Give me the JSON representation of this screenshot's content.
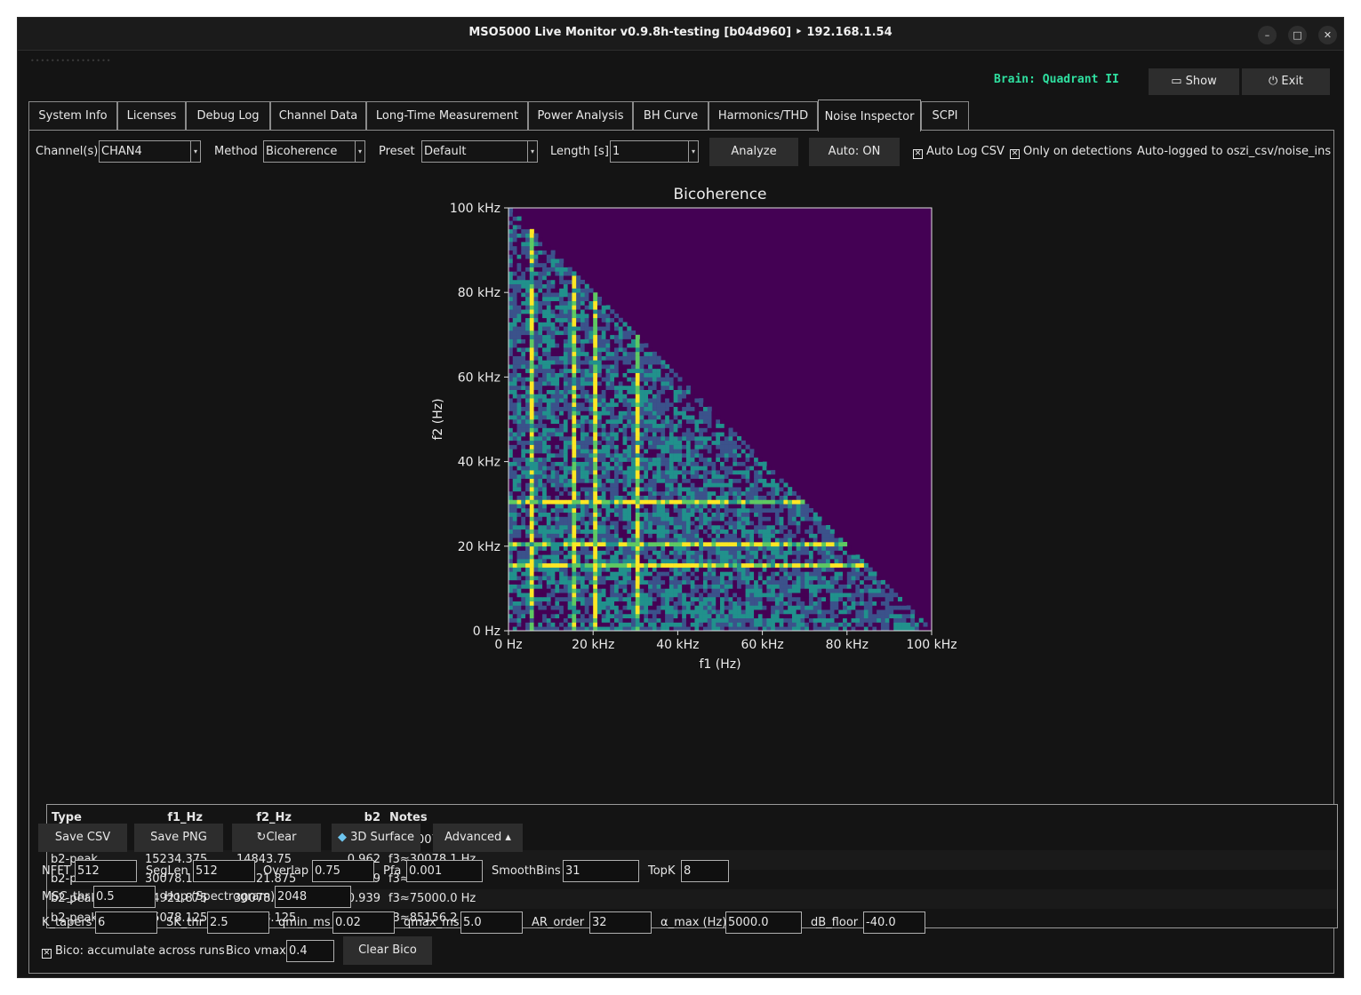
{
  "window": {
    "title": "MSO5000 Live Monitor v0.9.8h-testing [b04d960] ‣ 192.168.1.54",
    "controls": [
      "–",
      "□",
      "✕"
    ]
  },
  "header": {
    "brain_label": "Brain: Quadrant II",
    "show_label": "Show",
    "exit_label": "Exit"
  },
  "tabs": [
    {
      "label": "System Info"
    },
    {
      "label": "Licenses"
    },
    {
      "label": "Debug Log"
    },
    {
      "label": "Channel Data"
    },
    {
      "label": "Long-Time Measurement"
    },
    {
      "label": "Power Analysis"
    },
    {
      "label": "BH Curve"
    },
    {
      "label": "Harmonics/THD"
    },
    {
      "label": "Noise Inspector",
      "active": true
    },
    {
      "label": "SCPI"
    }
  ],
  "controls": {
    "channel_label": "Channel(s)",
    "channel_value": "CHAN4",
    "method_label": "Method",
    "method_value": "Bicoherence",
    "preset_label": "Preset",
    "preset_value": "Default",
    "length_label": "Length [s]",
    "length_value": "1",
    "analyze_label": "Analyze",
    "auto_label": "Auto: ON",
    "auto_log_csv_label": "Auto Log CSV",
    "auto_log_csv_checked": true,
    "only_detections_label": "Only on detections",
    "only_detections_checked": true,
    "auto_logged_text": "Auto-logged to oszi_csv/noise_ins"
  },
  "chart_data": {
    "type": "heatmap",
    "title": "Bicoherence",
    "xlabel": "f1 (Hz)",
    "ylabel": "f2 (Hz)",
    "xlim": [
      0,
      100000
    ],
    "ylim": [
      0,
      100000
    ],
    "x_ticks": [
      "0 Hz",
      "20 kHz",
      "40 kHz",
      "60 kHz",
      "80 kHz",
      "100 kHz"
    ],
    "y_ticks": [
      "0 Hz",
      "20 kHz",
      "40 kHz",
      "60 kHz",
      "80 kHz",
      "100 kHz"
    ],
    "region": "lower-left triangle (f1 + f2 <= 100 kHz)",
    "colormap": [
      "#440154",
      "#3b528b",
      "#21918c",
      "#5ec962",
      "#fde725"
    ],
    "empty_color": "#440154",
    "bright_lines_f1_hz": [
      5000,
      15000,
      20000,
      30000
    ],
    "bright_lines_f2_hz": [
      15000,
      20000,
      30000
    ]
  },
  "table": {
    "columns": [
      "Type",
      "f1_Hz",
      "f2_Hz",
      "b2",
      "Notes"
    ],
    "rows": [
      [
        "b2-peak",
        "14843.75",
        "15234.375",
        "0.962",
        "f3≈30078.1 Hz"
      ],
      [
        "b2-peak",
        "15234.375",
        "14843.75",
        "0.962",
        "f3≈30078.1 Hz"
      ],
      [
        "b2-peak",
        "30078.125",
        "44921.875",
        "0.939",
        "f3≈75000.0 Hz"
      ],
      [
        "b2-peak",
        "44921.875",
        "30078.125",
        "0.939",
        "f3≈75000.0 Hz"
      ],
      [
        "b2-peak",
        "55078.125",
        "30078.125",
        "0.925",
        "f3≈85156.2 Hz"
      ]
    ]
  },
  "actions": {
    "save_csv": "Save CSV",
    "save_png": "Save PNG",
    "clear": "Clear",
    "surface_3d": "3D Surface",
    "advanced": "Advanced ▴"
  },
  "params": {
    "nfft_label": "NFFT",
    "nfft": "512",
    "seglen_label": "SegLen",
    "seglen": "512",
    "overlap_label": "Overlap",
    "overlap": "0.75",
    "pfa_label": "Pfa",
    "pfa": "0.001",
    "smoothbins_label": "SmoothBins",
    "smoothbins": "31",
    "topk_label": "TopK",
    "topk": "8",
    "msc_thr_label": "MSC_thr",
    "msc_thr": "0.5",
    "hop_label": "Hop (Spectrogram)",
    "hop": "2048",
    "k_tapers_label": "K_tapers",
    "k_tapers": "6",
    "sk_thr_label": "SK_thr",
    "sk_thr": "2.5",
    "qmin_label": "qmin_ms",
    "qmin": "0.02",
    "qmax_label": "qmax_ms",
    "qmax": "5.0",
    "ar_order_label": "AR_order",
    "ar_order": "32",
    "alpha_max_label": "α_max (Hz)",
    "alpha_max": "5000.0",
    "db_floor_label": "dB_floor",
    "db_floor": "-40.0",
    "bico_accumulate_label": "Bico: accumulate across runs",
    "bico_accumulate_checked": true,
    "bico_vmax_label": "Bico vmax",
    "bico_vmax": "0.4",
    "clear_bico_label": "Clear Bico"
  }
}
